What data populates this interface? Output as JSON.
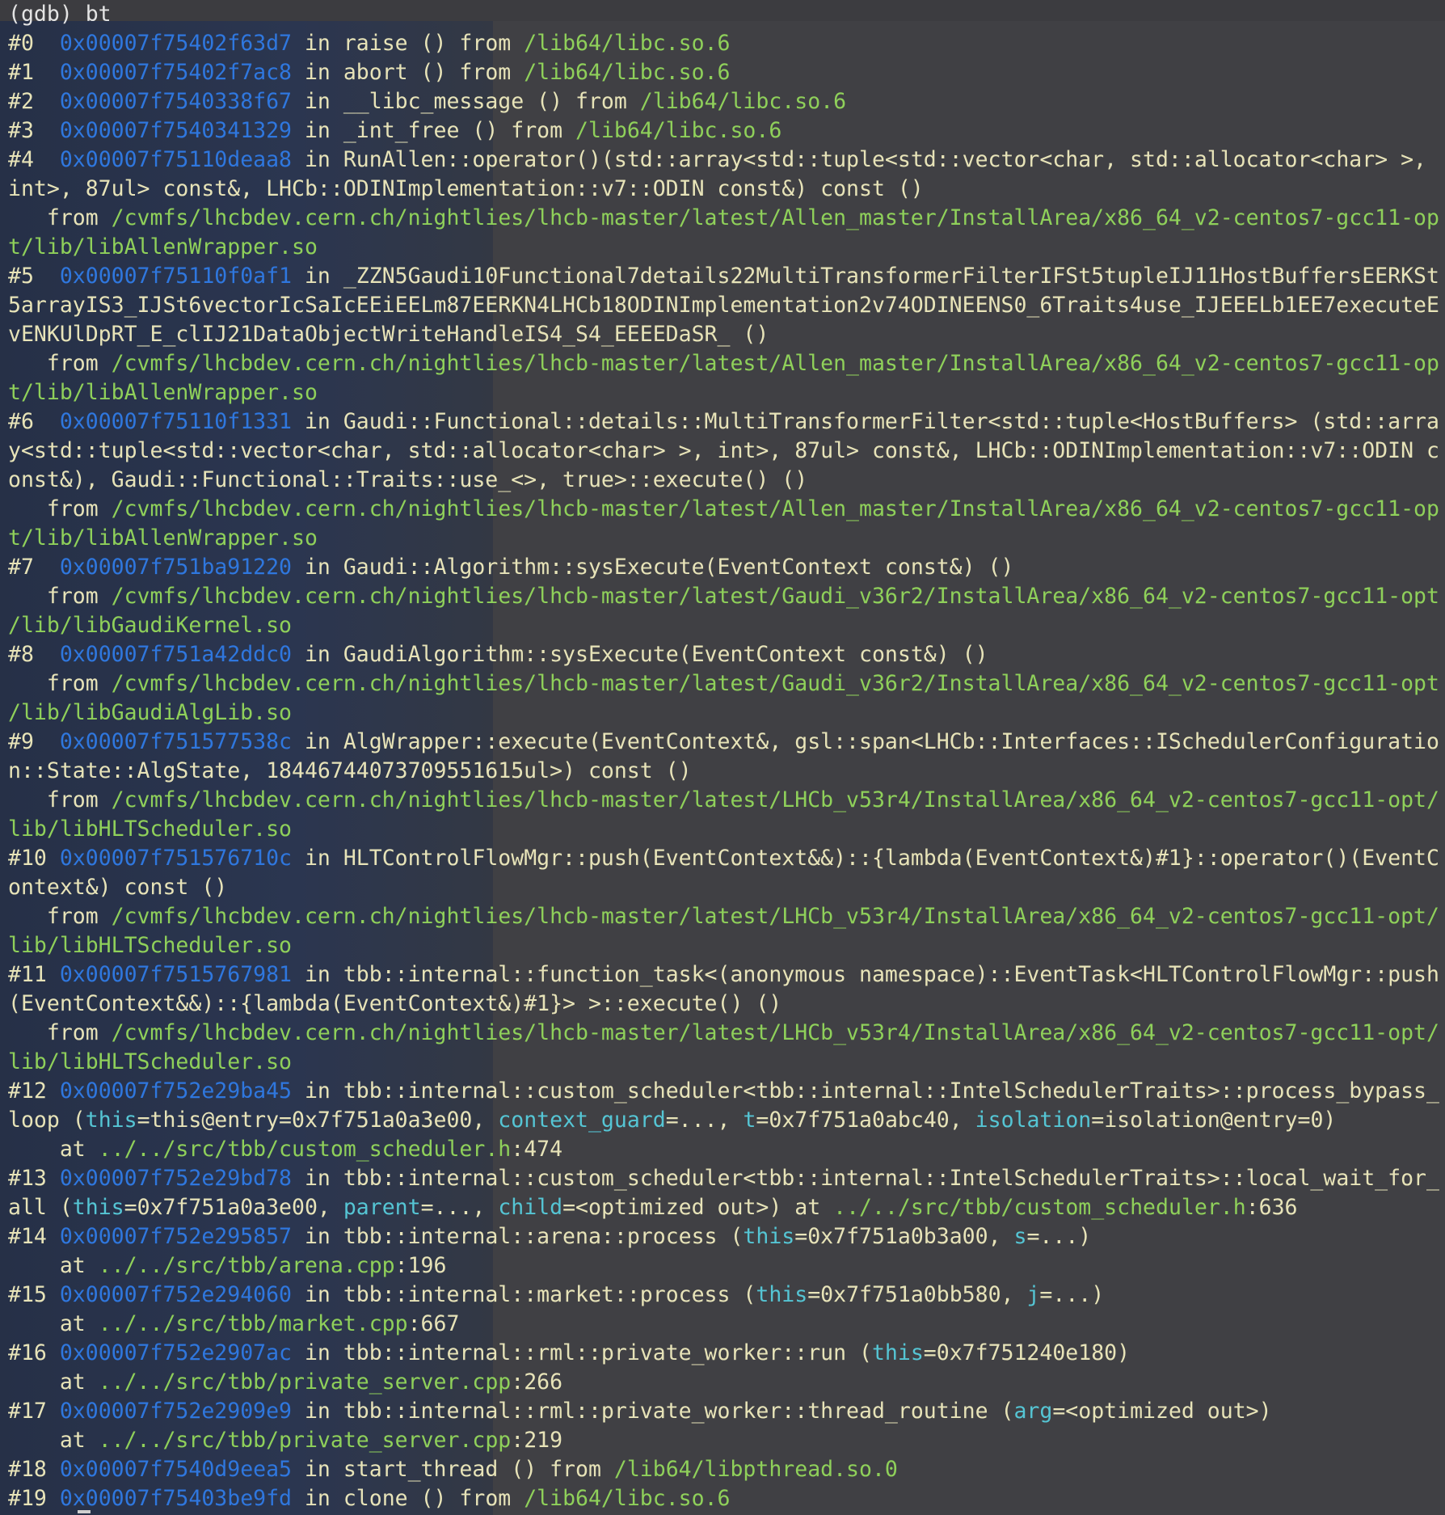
{
  "terminal": {
    "lines": [
      [
        [
          "pm",
          "(gdb) bt"
        ]
      ],
      [
        [
          "tx",
          "#0  "
        ],
        [
          "ad",
          "0x00007f75402f63d7"
        ],
        [
          "tx",
          " in raise () from "
        ],
        [
          "pa",
          "/lib64/libc.so.6"
        ]
      ],
      [
        [
          "tx",
          "#1  "
        ],
        [
          "ad",
          "0x00007f75402f7ac8"
        ],
        [
          "tx",
          " in abort () from "
        ],
        [
          "pa",
          "/lib64/libc.so.6"
        ]
      ],
      [
        [
          "tx",
          "#2  "
        ],
        [
          "ad",
          "0x00007f7540338f67"
        ],
        [
          "tx",
          " in __libc_message () from "
        ],
        [
          "pa",
          "/lib64/libc.so.6"
        ]
      ],
      [
        [
          "tx",
          "#3  "
        ],
        [
          "ad",
          "0x00007f7540341329"
        ],
        [
          "tx",
          " in _int_free () from "
        ],
        [
          "pa",
          "/lib64/libc.so.6"
        ]
      ],
      [
        [
          "tx",
          "#4  "
        ],
        [
          "ad",
          "0x00007f75110deaa8"
        ],
        [
          "tx",
          " in RunAllen::operator()(std::array<std::tuple<std::vector<char, std::allocator<char> >,"
        ]
      ],
      [
        [
          "tx",
          "int>, 87ul> const&, LHCb::ODINImplementation::v7::ODIN const&) const ()"
        ]
      ],
      [
        [
          "tx",
          "   from "
        ],
        [
          "pa",
          "/cvmfs/lhcbdev.cern.ch/nightlies/lhcb-master/latest/Allen_master/InstallArea/x86_64_v2-centos7-gcc11-op"
        ]
      ],
      [
        [
          "pa",
          "t/lib/libAllenWrapper.so"
        ]
      ],
      [
        [
          "tx",
          "#5  "
        ],
        [
          "ad",
          "0x00007f75110f0af1"
        ],
        [
          "tx",
          " in _ZZN5Gaudi10Functional7details22MultiTransformerFilterIFSt5tupleIJ11HostBuffersEERKSt"
        ]
      ],
      [
        [
          "tx",
          "5arrayIS3_IJSt6vectorIcSaIcEEiEELm87EERKN4LHCb18ODINImplementation2v74ODINEENS0_6Traits4use_IJEEELb1EE7executeE"
        ]
      ],
      [
        [
          "tx",
          "vENKUlDpRT_E_clIJ21DataObjectWriteHandleIS4_S4_EEEEDaSR_ ()"
        ]
      ],
      [
        [
          "tx",
          "   from "
        ],
        [
          "pa",
          "/cvmfs/lhcbdev.cern.ch/nightlies/lhcb-master/latest/Allen_master/InstallArea/x86_64_v2-centos7-gcc11-op"
        ]
      ],
      [
        [
          "pa",
          "t/lib/libAllenWrapper.so"
        ]
      ],
      [
        [
          "tx",
          "#6  "
        ],
        [
          "ad",
          "0x00007f75110f1331"
        ],
        [
          "tx",
          " in Gaudi::Functional::details::MultiTransformerFilter<std::tuple<HostBuffers> (std::arra"
        ]
      ],
      [
        [
          "tx",
          "y<std::tuple<std::vector<char, std::allocator<char> >, int>, 87ul> const&, LHCb::ODINImplementation::v7::ODIN c"
        ]
      ],
      [
        [
          "tx",
          "onst&), Gaudi::Functional::Traits::use_<>, true>::execute() ()"
        ]
      ],
      [
        [
          "tx",
          "   from "
        ],
        [
          "pa",
          "/cvmfs/lhcbdev.cern.ch/nightlies/lhcb-master/latest/Allen_master/InstallArea/x86_64_v2-centos7-gcc11-op"
        ]
      ],
      [
        [
          "pa",
          "t/lib/libAllenWrapper.so"
        ]
      ],
      [
        [
          "tx",
          "#7  "
        ],
        [
          "ad",
          "0x00007f751ba91220"
        ],
        [
          "tx",
          " in Gaudi::Algorithm::sysExecute(EventContext const&) ()"
        ]
      ],
      [
        [
          "tx",
          "   from "
        ],
        [
          "pa",
          "/cvmfs/lhcbdev.cern.ch/nightlies/lhcb-master/latest/Gaudi_v36r2/InstallArea/x86_64_v2-centos7-gcc11-opt"
        ]
      ],
      [
        [
          "pa",
          "/lib/libGaudiKernel.so"
        ]
      ],
      [
        [
          "tx",
          "#8  "
        ],
        [
          "ad",
          "0x00007f751a42ddc0"
        ],
        [
          "tx",
          " in GaudiAlgorithm::sysExecute(EventContext const&) ()"
        ]
      ],
      [
        [
          "tx",
          "   from "
        ],
        [
          "pa",
          "/cvmfs/lhcbdev.cern.ch/nightlies/lhcb-master/latest/Gaudi_v36r2/InstallArea/x86_64_v2-centos7-gcc11-opt"
        ]
      ],
      [
        [
          "pa",
          "/lib/libGaudiAlgLib.so"
        ]
      ],
      [
        [
          "tx",
          "#9  "
        ],
        [
          "ad",
          "0x00007f751577538c"
        ],
        [
          "tx",
          " in AlgWrapper::execute(EventContext&, gsl::span<LHCb::Interfaces::ISchedulerConfiguratio"
        ]
      ],
      [
        [
          "tx",
          "n::State::AlgState, 18446744073709551615ul>) const ()"
        ]
      ],
      [
        [
          "tx",
          "   from "
        ],
        [
          "pa",
          "/cvmfs/lhcbdev.cern.ch/nightlies/lhcb-master/latest/LHCb_v53r4/InstallArea/x86_64_v2-centos7-gcc11-opt/"
        ]
      ],
      [
        [
          "pa",
          "lib/libHLTScheduler.so"
        ]
      ],
      [
        [
          "tx",
          "#10 "
        ],
        [
          "ad",
          "0x00007f751576710c"
        ],
        [
          "tx",
          " in HLTControlFlowMgr::push(EventContext&&)::{lambda(EventContext&)#1}::operator()(EventC"
        ]
      ],
      [
        [
          "tx",
          "ontext&) const ()"
        ]
      ],
      [
        [
          "tx",
          "   from "
        ],
        [
          "pa",
          "/cvmfs/lhcbdev.cern.ch/nightlies/lhcb-master/latest/LHCb_v53r4/InstallArea/x86_64_v2-centos7-gcc11-opt/"
        ]
      ],
      [
        [
          "pa",
          "lib/libHLTScheduler.so"
        ]
      ],
      [
        [
          "tx",
          "#11 "
        ],
        [
          "ad",
          "0x00007f7515767981"
        ],
        [
          "tx",
          " in tbb::internal::function_task<(anonymous namespace)::EventTask<HLTControlFlowMgr::push"
        ]
      ],
      [
        [
          "tx",
          "(EventContext&&)::{lambda(EventContext&)#1}> >::execute() ()"
        ]
      ],
      [
        [
          "tx",
          "   from "
        ],
        [
          "pa",
          "/cvmfs/lhcbdev.cern.ch/nightlies/lhcb-master/latest/LHCb_v53r4/InstallArea/x86_64_v2-centos7-gcc11-opt/"
        ]
      ],
      [
        [
          "pa",
          "lib/libHLTScheduler.so"
        ]
      ],
      [
        [
          "tx",
          "#12 "
        ],
        [
          "ad",
          "0x00007f752e29ba45"
        ],
        [
          "tx",
          " in tbb::internal::custom_scheduler<tbb::internal::IntelSchedulerTraits>::process_bypass_"
        ]
      ],
      [
        [
          "tx",
          "loop ("
        ],
        [
          "ar",
          "this"
        ],
        [
          "tx",
          "=this@entry=0x7f751a0a3e00, "
        ],
        [
          "ar",
          "context_guard"
        ],
        [
          "tx",
          "=..., "
        ],
        [
          "ar",
          "t"
        ],
        [
          "tx",
          "=0x7f751a0abc40, "
        ],
        [
          "ar",
          "isolation"
        ],
        [
          "tx",
          "=isolation@entry=0)"
        ]
      ],
      [
        [
          "tx",
          "    at "
        ],
        [
          "pa",
          "../../src/tbb/custom_scheduler.h"
        ],
        [
          "tx",
          ":474"
        ]
      ],
      [
        [
          "tx",
          "#13 "
        ],
        [
          "ad",
          "0x00007f752e29bd78"
        ],
        [
          "tx",
          " in tbb::internal::custom_scheduler<tbb::internal::IntelSchedulerTraits>::local_wait_for_"
        ]
      ],
      [
        [
          "tx",
          "all ("
        ],
        [
          "ar",
          "this"
        ],
        [
          "tx",
          "=0x7f751a0a3e00, "
        ],
        [
          "ar",
          "parent"
        ],
        [
          "tx",
          "=..., "
        ],
        [
          "ar",
          "child"
        ],
        [
          "tx",
          "=<optimized out>) at "
        ],
        [
          "pa",
          "../../src/tbb/custom_scheduler.h"
        ],
        [
          "tx",
          ":636"
        ]
      ],
      [
        [
          "tx",
          "#14 "
        ],
        [
          "ad",
          "0x00007f752e295857"
        ],
        [
          "tx",
          " in tbb::internal::arena::process ("
        ],
        [
          "ar",
          "this"
        ],
        [
          "tx",
          "=0x7f751a0b3a00, "
        ],
        [
          "ar",
          "s"
        ],
        [
          "tx",
          "=...)"
        ]
      ],
      [
        [
          "tx",
          "    at "
        ],
        [
          "pa",
          "../../src/tbb/arena.cpp"
        ],
        [
          "tx",
          ":196"
        ]
      ],
      [
        [
          "tx",
          "#15 "
        ],
        [
          "ad",
          "0x00007f752e294060"
        ],
        [
          "tx",
          " in tbb::internal::market::process ("
        ],
        [
          "ar",
          "this"
        ],
        [
          "tx",
          "=0x7f751a0bb580, "
        ],
        [
          "ar",
          "j"
        ],
        [
          "tx",
          "=...)"
        ]
      ],
      [
        [
          "tx",
          "    at "
        ],
        [
          "pa",
          "../../src/tbb/market.cpp"
        ],
        [
          "tx",
          ":667"
        ]
      ],
      [
        [
          "tx",
          "#16 "
        ],
        [
          "ad",
          "0x00007f752e2907ac"
        ],
        [
          "tx",
          " in tbb::internal::rml::private_worker::run ("
        ],
        [
          "ar",
          "this"
        ],
        [
          "tx",
          "=0x7f751240e180)"
        ]
      ],
      [
        [
          "tx",
          "    at "
        ],
        [
          "pa",
          "../../src/tbb/private_server.cpp"
        ],
        [
          "tx",
          ":266"
        ]
      ],
      [
        [
          "tx",
          "#17 "
        ],
        [
          "ad",
          "0x00007f752e2909e9"
        ],
        [
          "tx",
          " in tbb::internal::rml::private_worker::thread_routine ("
        ],
        [
          "ar",
          "arg"
        ],
        [
          "tx",
          "=<optimized out>)"
        ]
      ],
      [
        [
          "tx",
          "    at "
        ],
        [
          "pa",
          "../../src/tbb/private_server.cpp"
        ],
        [
          "tx",
          ":219"
        ]
      ],
      [
        [
          "tx",
          "#18 "
        ],
        [
          "ad",
          "0x00007f7540d9eea5"
        ],
        [
          "tx",
          " in start_thread () from "
        ],
        [
          "pa",
          "/lib64/libpthread.so.0"
        ]
      ],
      [
        [
          "tx",
          "#19 "
        ],
        [
          "ad",
          "0x00007f75403be9fd"
        ],
        [
          "tx",
          " in clone () from "
        ],
        [
          "pa",
          "/lib64/libc.so.6"
        ]
      ]
    ]
  }
}
